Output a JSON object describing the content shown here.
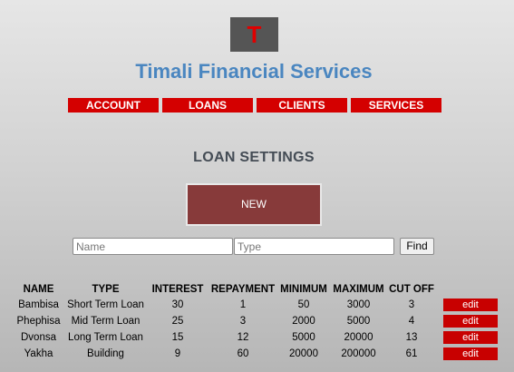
{
  "logo": {
    "letter": "T"
  },
  "site_title": "Timali Financial Services",
  "nav": [
    "ACCOUNT",
    "LOANS",
    "CLIENTS",
    "SERVICES"
  ],
  "section_title": "LOAN SETTINGS",
  "new_button": "NEW",
  "filter": {
    "name_placeholder": "Name",
    "type_placeholder": "Type",
    "find_label": "Find"
  },
  "table": {
    "headers": [
      "NAME",
      "TYPE",
      "INTEREST",
      "REPAYMENT",
      "MINIMUM",
      "MAXIMUM",
      "CUT OFF"
    ],
    "rows": [
      {
        "name": "Bambisa",
        "type": "Short Term Loan",
        "interest": "30",
        "repayment": "1",
        "minimum": "50",
        "maximum": "3000",
        "cut_off": "3",
        "action": "edit"
      },
      {
        "name": "Phephisa",
        "type": "Mid Term Loan",
        "interest": "25",
        "repayment": "3",
        "minimum": "2000",
        "maximum": "5000",
        "cut_off": "4",
        "action": "edit"
      },
      {
        "name": "Dvonsa",
        "type": "Long Term Loan",
        "interest": "15",
        "repayment": "12",
        "minimum": "5000",
        "maximum": "20000",
        "cut_off": "13",
        "action": "edit"
      },
      {
        "name": "Yakha",
        "type": "Building",
        "interest": "9",
        "repayment": "60",
        "minimum": "20000",
        "maximum": "200000",
        "cut_off": "61",
        "action": "edit"
      }
    ]
  },
  "colors": {
    "brand_title": "#4a86c0",
    "nav_bg": "#d40000",
    "new_button_bg": "#873a3a",
    "edit_button_bg": "#c80000",
    "logo_bg": "#555555",
    "logo_letter": "#e00000"
  }
}
